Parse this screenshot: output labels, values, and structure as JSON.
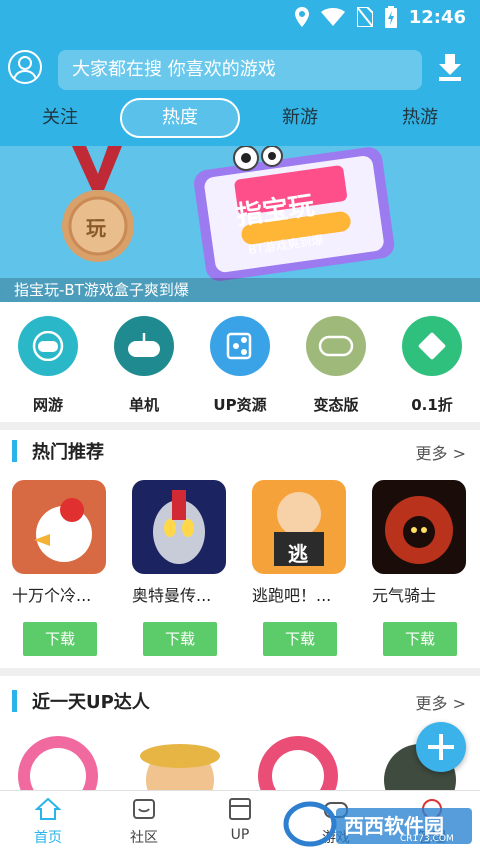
{
  "status_bar": {
    "time": "12:46"
  },
  "header": {
    "search_placeholder": "大家都在搜 你喜欢的游戏",
    "tabs": [
      {
        "label": "关注",
        "active": false
      },
      {
        "label": "热度",
        "active": true
      },
      {
        "label": "新游",
        "active": false
      },
      {
        "label": "热游",
        "active": false
      }
    ]
  },
  "banner": {
    "caption": "指宝玩-BT游戏盒子爽到爆",
    "medal_text": "玩",
    "sign_text": "指宝玩",
    "ribbon_text": "BT游戏爽到爆"
  },
  "categories": [
    {
      "label": "网游",
      "icon": "gamepad-icon",
      "color": "#2ab8c9"
    },
    {
      "label": "单机",
      "icon": "joystick-icon",
      "color": "#1f8a8f"
    },
    {
      "label": "UP资源",
      "icon": "share-icon",
      "color": "#3aa3e8"
    },
    {
      "label": "变态版",
      "icon": "bt-gamepad-icon",
      "color": "#9fb97a"
    },
    {
      "label": "0.1折",
      "icon": "discount-ticket-icon",
      "color": "#2fc07e"
    }
  ],
  "hot": {
    "title": "热门推荐",
    "more": "更多 >",
    "games": [
      {
        "name": "十万个冷...",
        "download": "下载"
      },
      {
        "name": "奥特曼传...",
        "download": "下载"
      },
      {
        "name": "逃跑吧！...",
        "download": "下载",
        "icon_char": "逃"
      },
      {
        "name": "元气骑士",
        "download": "下载"
      }
    ]
  },
  "up_section": {
    "title": "近一天UP达人",
    "more": "更多 >"
  },
  "bottom_nav": [
    {
      "label": "首页",
      "active": true
    },
    {
      "label": "社区",
      "active": false
    },
    {
      "label": "UP",
      "active": false
    },
    {
      "label": "游戏",
      "active": false
    },
    {
      "label": "管理",
      "active": false
    }
  ],
  "watermark": {
    "text": "西西软件园",
    "sub": "CR173.COM"
  },
  "colors": {
    "primary": "#31b3e5",
    "download_green": "#5ccb6a",
    "accent": "#2ab4ea"
  }
}
